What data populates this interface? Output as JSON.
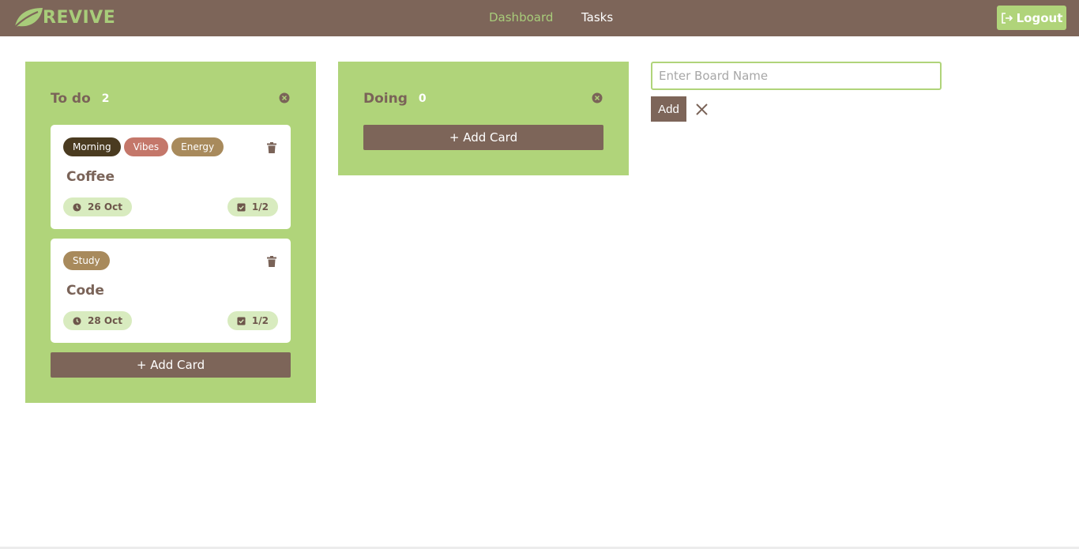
{
  "brand": {
    "name": "REVIVE",
    "color": "#a8cc7a"
  },
  "nav": {
    "dashboard": "Dashboard",
    "tasks": "Tasks",
    "logout": "Logout"
  },
  "colors": {
    "navbar": "#7d6559",
    "board": "#b0d47a",
    "accent_text": "#7a6358",
    "pill_bg": "#d8ebbf"
  },
  "boards": [
    {
      "title": "To do",
      "count": "2",
      "cards": [
        {
          "title": "Coffee",
          "tags": [
            {
              "label": "Morning",
              "color": "#4a3b20"
            },
            {
              "label": "Vibes",
              "color": "#c4776a"
            },
            {
              "label": "Energy",
              "color": "#a88a5c"
            }
          ],
          "date": "26 Oct",
          "tasks": "1/2"
        },
        {
          "title": "Code",
          "tags": [
            {
              "label": "Study",
              "color": "#a88a5c"
            }
          ],
          "date": "28 Oct",
          "tasks": "1/2"
        }
      ],
      "add_card_label": "+ Add Card"
    },
    {
      "title": "Doing",
      "count": "0",
      "cards": [],
      "add_card_label": "+ Add Card"
    }
  ],
  "new_board": {
    "placeholder": "Enter Board Name",
    "value": "",
    "add_label": "Add"
  },
  "icons": {
    "logo": "leaf-icon",
    "logout": "logout-icon",
    "board_close": "close-circle-icon",
    "card_delete": "trash-icon",
    "date": "clock-icon",
    "tasks": "checkbox-icon",
    "cancel": "close-icon"
  }
}
